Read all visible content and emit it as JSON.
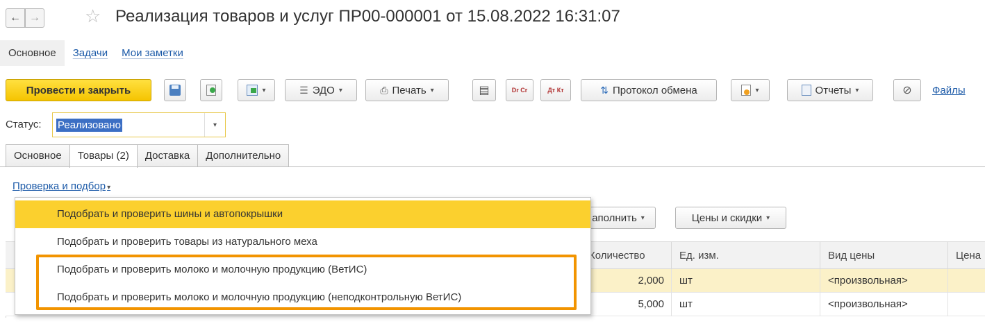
{
  "window": {
    "title": "Реализация товаров и услуг ПР00-000001 от 15.08.2022 16:31:07",
    "back_icon": "←",
    "forward_icon": "→",
    "star_icon": "☆"
  },
  "top_nav": {
    "items": [
      {
        "label": "Основное",
        "active": true
      },
      {
        "label": "Задачи",
        "active": false
      },
      {
        "label": "Мои заметки",
        "active": false
      }
    ]
  },
  "toolbar": {
    "post_close_label": "Провести и закрыть",
    "edo_label": "ЭДО",
    "print_label": "Печать",
    "dr_cr_label": "Dr Cr",
    "dt_kt_label": "Дт Кт",
    "exchange_log_label": "Протокол обмена",
    "reports_label": "Отчеты",
    "files_label": "Файлы",
    "caret": "▾"
  },
  "status": {
    "label": "Статус:",
    "value": "Реализовано",
    "dropdown_icon": "▾"
  },
  "tabs": [
    {
      "label": "Основное",
      "active": false
    },
    {
      "label": "Товары (2)",
      "active": true
    },
    {
      "label": "Доставка",
      "active": false
    },
    {
      "label": "Дополнительно",
      "active": false
    }
  ],
  "goods": {
    "check_link": "Проверка и подбор",
    "fill_label": "аполнить",
    "prices_label": "Цены и скидки",
    "columns": [
      "Количество",
      "Ед. изм.",
      "Вид цены",
      "Цена"
    ],
    "rows": [
      {
        "qty": "2,000",
        "unit": "шт",
        "price_type": "<произвольная>"
      },
      {
        "qty": "5,000",
        "unit": "шт",
        "price_type": "<произвольная>"
      }
    ]
  },
  "popup": {
    "items": [
      "Подобрать и проверить шины и автопокрышки",
      "Подобрать и проверить товары из натурального меха",
      "Подобрать и проверить молоко и молочную продукцию (ВетИС)",
      "Подобрать и проверить молоко и молочную продукцию (неподконтрольную ВетИС)"
    ]
  },
  "colors": {
    "accent_yellow": "#fbd02e",
    "highlight_orange": "#f29400",
    "link_blue": "#1c5aa8",
    "selected_blue": "#3c6fc4"
  }
}
